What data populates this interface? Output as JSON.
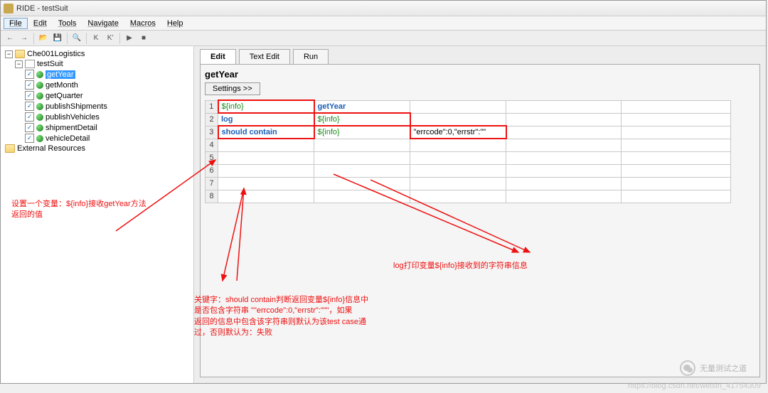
{
  "window": {
    "title": "RIDE - testSuit"
  },
  "menu": {
    "file": "File",
    "edit": "Edit",
    "tools": "Tools",
    "navigate": "Navigate",
    "macros": "Macros",
    "help": "Help"
  },
  "tree": {
    "project": "Che001Logistics",
    "suite": "testSuit",
    "cases": [
      {
        "name": "getYear",
        "selected": true
      },
      {
        "name": "getMonth"
      },
      {
        "name": "getQuarter"
      },
      {
        "name": "publishShipments"
      },
      {
        "name": "publishVehicles"
      },
      {
        "name": "shipmentDetail"
      },
      {
        "name": "vehicleDetail"
      }
    ],
    "external": "External Resources"
  },
  "tabs": {
    "edit": "Edit",
    "textEdit": "Text Edit",
    "run": "Run"
  },
  "editor": {
    "name": "getYear",
    "settings_btn": "Settings >>",
    "rows": [
      {
        "num": "1",
        "c1": "${info}",
        "c2": "getYear",
        "c3": "",
        "c1_cls": "txt-green red-box",
        "c2_cls": "txt-blue",
        "c3_cls": ""
      },
      {
        "num": "2",
        "c1": "log",
        "c2": "${info}",
        "c3": "",
        "c1_cls": "txt-blue",
        "c2_cls": "txt-green red-box",
        "c3_cls": ""
      },
      {
        "num": "3",
        "c1": "should contain",
        "c2": "${info}",
        "c3": "\"errcode\":0,\"errstr\":\"\"",
        "c1_cls": "txt-blue red-box",
        "c2_cls": "txt-green",
        "c3_cls": "red-box"
      },
      {
        "num": "4",
        "c1": "",
        "c2": "",
        "c3": ""
      },
      {
        "num": "5",
        "c1": "",
        "c2": "",
        "c3": ""
      },
      {
        "num": "6",
        "c1": "",
        "c2": "",
        "c3": ""
      },
      {
        "num": "7",
        "c1": "",
        "c2": "",
        "c3": ""
      },
      {
        "num": "8",
        "c1": "",
        "c2": "",
        "c3": ""
      }
    ]
  },
  "annotations": {
    "a1_l1": "设置一个变量：${info}接收getYear方法",
    "a1_l2": "返回的值",
    "a2": "log打印变量${info}接收到的字符串信息",
    "a3_l1": "关键字：should contain判断返回变量${info}信息中",
    "a3_l2": "是否包含字符串 \"\"errcode\":0,\"errstr\":\"\"\"，如果",
    "a3_l3": "返回的信息中包含该字符串则默认为该test case通",
    "a3_l4": "过，否则默认为：失败"
  },
  "footer": {
    "wechat": "无量测试之道",
    "watermark": "https://blog.csdn.net/weixin_41754309"
  }
}
